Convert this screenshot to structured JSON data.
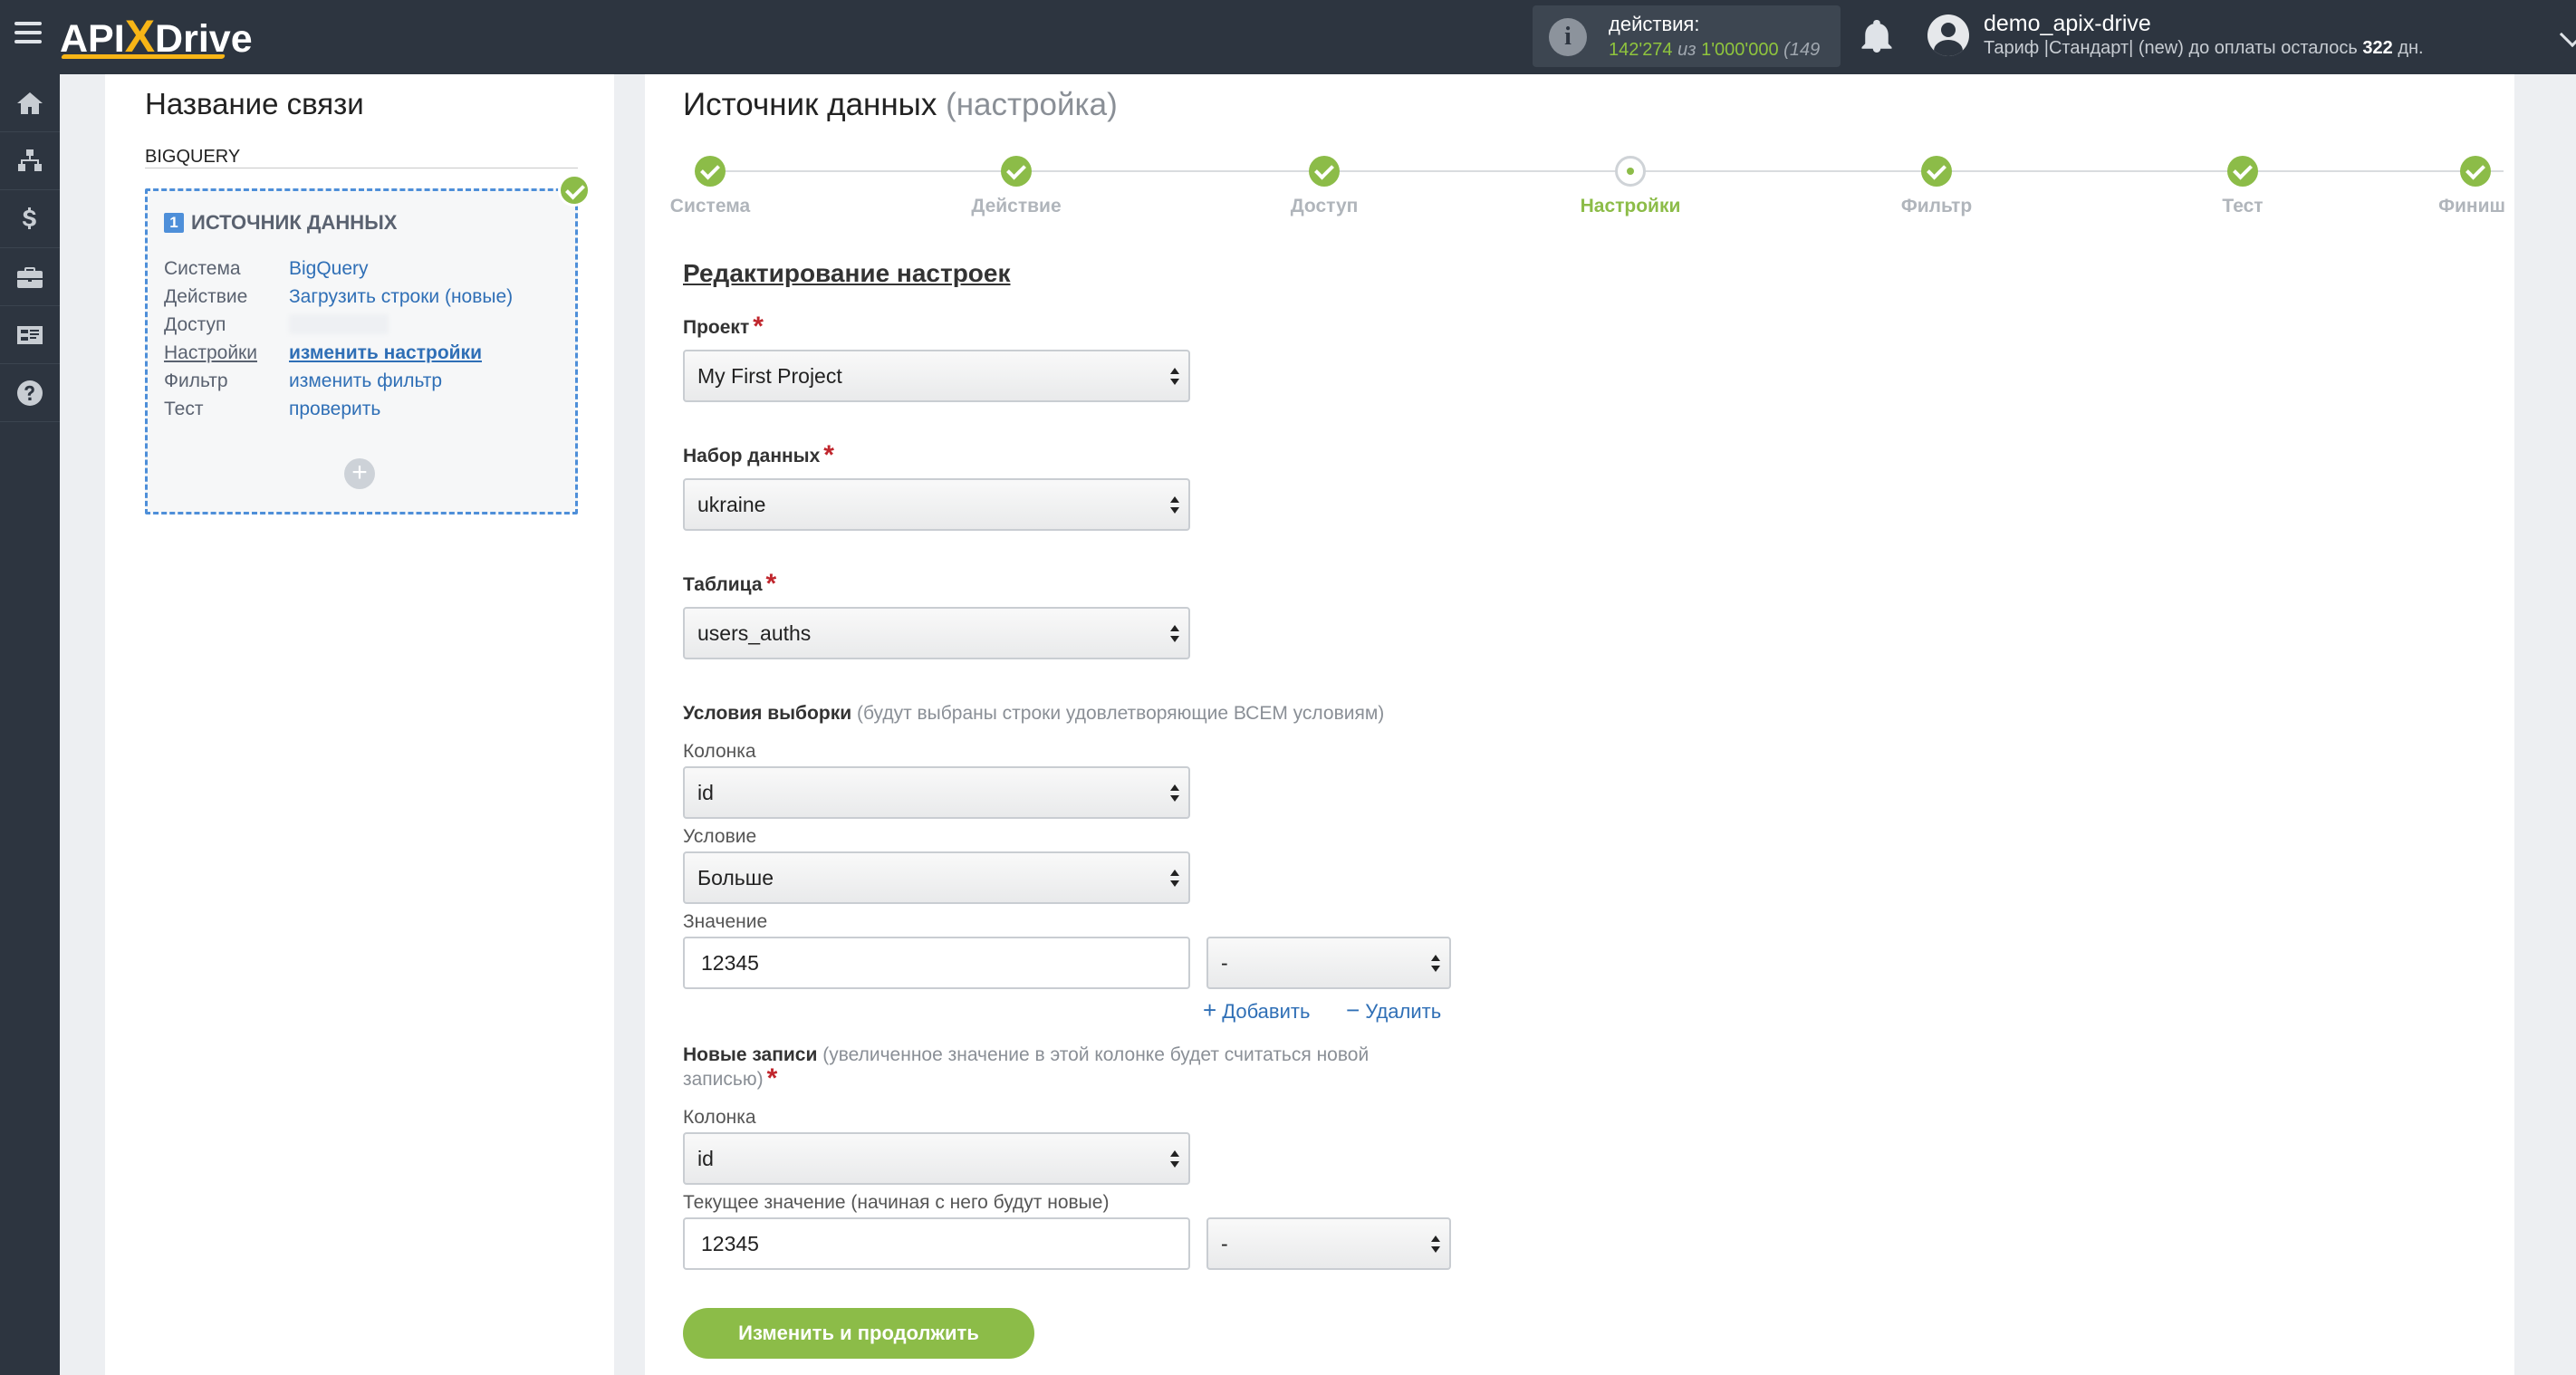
{
  "topbar": {
    "logo": {
      "part1": "API",
      "x": "X",
      "part2": "Drive"
    },
    "actions": {
      "label": "действия:",
      "used": "142'274",
      "of": "из",
      "total": "1'000'000",
      "extra": "(149"
    },
    "user": {
      "name": "demo_apix-drive",
      "tariff_prefix": "Тариф |Стандарт| (new) до оплаты осталось",
      "days": "322",
      "days_suffix": "дн."
    }
  },
  "sidebar": {
    "items": [
      "home-icon",
      "sitemap-icon",
      "dollar-icon",
      "briefcase-icon",
      "id-card-icon",
      "help-icon"
    ]
  },
  "left_panel": {
    "title": "Название связи",
    "connection_name": "BIGQUERY",
    "source": {
      "number": "1",
      "heading": "ИСТОЧНИК ДАННЫХ",
      "rows": [
        {
          "key": "Система",
          "value": "BigQuery"
        },
        {
          "key": "Действие",
          "value": "Загрузить строки (новые)"
        },
        {
          "key": "Доступ",
          "value": ""
        },
        {
          "key": "Настройки",
          "value": "изменить настройки"
        },
        {
          "key": "Фильтр",
          "value": "изменить фильтр"
        },
        {
          "key": "Тест",
          "value": "проверить"
        }
      ]
    },
    "add_symbol": "+"
  },
  "main": {
    "title": "Источник данных",
    "title_sub": "(настройка)",
    "steps": [
      {
        "label": "Система",
        "state": "done"
      },
      {
        "label": "Действие",
        "state": "done"
      },
      {
        "label": "Доступ",
        "state": "done"
      },
      {
        "label": "Настройки",
        "state": "current"
      },
      {
        "label": "Фильтр",
        "state": "done"
      },
      {
        "label": "Тест",
        "state": "done"
      },
      {
        "label": "Финиш",
        "state": "done"
      }
    ],
    "section_title": "Редактирование настроек",
    "project": {
      "label": "Проект",
      "value": "My First Project"
    },
    "dataset": {
      "label": "Набор данных",
      "value": "ukraine"
    },
    "table": {
      "label": "Таблица",
      "value": "users_auths"
    },
    "conditions": {
      "label": "Условия выборки",
      "note": "(будут выбраны строки удовлетворяющие ВСЕМ условиям)",
      "column_label": "Колонка",
      "column_value": "id",
      "condition_label": "Условие",
      "condition_value": "Больше",
      "value_label": "Значение",
      "value_value": "12345",
      "value_modifier": "-",
      "add_label": "Добавить",
      "remove_label": "Удалить"
    },
    "new_records": {
      "label": "Новые записи",
      "note": "(увеличенное значение в этой колонке будет считаться новой записью)",
      "column_label": "Колонка",
      "column_value": "id",
      "current_label": "Текущее значение (начиная с него будут новые)",
      "current_value": "12345",
      "current_modifier": "-"
    },
    "submit_label": "Изменить и продолжить"
  },
  "colors": {
    "accent_green": "#8cbc48",
    "topbar": "#2d3540",
    "link_blue": "#2f6fb6",
    "required_red": "#c0262d"
  }
}
